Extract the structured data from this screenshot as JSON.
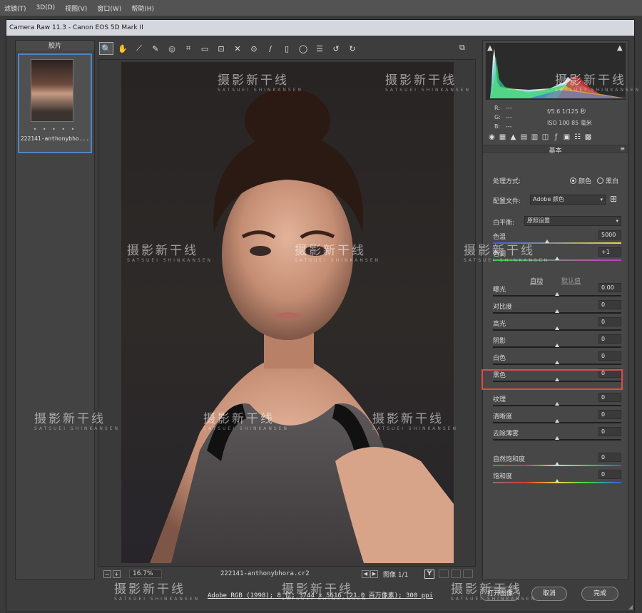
{
  "menubar": {
    "items": [
      "滤镜(T)",
      "3D(D)",
      "视图(V)",
      "窗口(W)",
      "帮助(H)"
    ]
  },
  "window": {
    "title": "Camera Raw 11.3 -  Canon EOS 5D Mark II"
  },
  "filmstrip": {
    "header": "胶片",
    "file_name": "222141-anthonybho...",
    "stars": "• • • • •"
  },
  "toolbar": {
    "tools": [
      {
        "name": "zoom-tool",
        "glyph": "🔍"
      },
      {
        "name": "hand-tool",
        "glyph": "✋"
      },
      {
        "name": "white-balance-tool",
        "glyph": "⟋"
      },
      {
        "name": "color-sampler-tool",
        "glyph": "✎"
      },
      {
        "name": "targeted-adjustment-tool",
        "glyph": "◎"
      },
      {
        "name": "crop-tool",
        "glyph": "⌗"
      },
      {
        "name": "straighten-tool",
        "glyph": "▭"
      },
      {
        "name": "transform-tool",
        "glyph": "⊡"
      },
      {
        "name": "spot-removal-tool",
        "glyph": "✕"
      },
      {
        "name": "red-eye-tool",
        "glyph": "⊙"
      },
      {
        "name": "adjustment-brush-tool",
        "glyph": "∕"
      },
      {
        "name": "graduated-filter-tool",
        "glyph": "▯"
      },
      {
        "name": "radial-filter-tool",
        "glyph": "◯"
      },
      {
        "name": "preferences-button",
        "glyph": "☰"
      },
      {
        "name": "rotate-left-button",
        "glyph": "↺"
      },
      {
        "name": "rotate-right-button",
        "glyph": "↻"
      }
    ]
  },
  "status": {
    "zoom": "16.7%",
    "file_name": "222141-anthonybhora.cr2",
    "image_label": "图像 1/1",
    "y_label": "Y"
  },
  "histogram": {
    "r_label": "R:",
    "g_label": "G:",
    "b_label": "B:",
    "r_val": "---",
    "g_val": "---",
    "b_val": "---",
    "exif_line1": "f/5.6   1/125 秒",
    "exif_line2": "ISO 100   85 毫米"
  },
  "basic": {
    "section_title": "基本",
    "treatment_label": "处理方式:",
    "treatment_color": "颜色",
    "treatment_bw": "黑白",
    "profile_label": "配置文件:",
    "profile_value": "Adobe 颜色",
    "wb_label": "白平衡:",
    "wb_value": "原照设置",
    "auto_link": "自动",
    "default_link": "默认值",
    "sliders": [
      {
        "key": "temperature",
        "label": "色温",
        "value": "5000",
        "pos": 0.42
      },
      {
        "key": "tint",
        "label": "色调",
        "value": "+1",
        "pos": 0.5
      },
      {
        "key": "exposure",
        "label": "曝光",
        "value": "0.00",
        "pos": 0.5
      },
      {
        "key": "contrast",
        "label": "对比度",
        "value": "0",
        "pos": 0.5
      },
      {
        "key": "highlights",
        "label": "高光",
        "value": "0",
        "pos": 0.5
      },
      {
        "key": "shadows",
        "label": "阴影",
        "value": "0",
        "pos": 0.5
      },
      {
        "key": "whites",
        "label": "白色",
        "value": "0",
        "pos": 0.5
      },
      {
        "key": "blacks",
        "label": "黑色",
        "value": "0",
        "pos": 0.5
      },
      {
        "key": "texture",
        "label": "纹理",
        "value": "0",
        "pos": 0.5
      },
      {
        "key": "clarity",
        "label": "清晰度",
        "value": "0",
        "pos": 0.5
      },
      {
        "key": "dehaze",
        "label": "去除薄雾",
        "value": "0",
        "pos": 0.5
      },
      {
        "key": "vibrance",
        "label": "自然饱和度",
        "value": "0",
        "pos": 0.5
      },
      {
        "key": "saturation",
        "label": "饱和度",
        "value": "0",
        "pos": 0.5
      }
    ]
  },
  "bottom": {
    "workflow_link": "Adobe RGB (1998); 8 位; 3744 x 5616 (21.0 百万像素); 300 ppi",
    "open_button": "打开图像",
    "cancel_button": "取消",
    "done_button": "完成"
  },
  "watermark": {
    "title": "摄影新干线",
    "sub": "SATSUEI SHINKANSEN"
  },
  "colors": {
    "highlight": "#e04a4a",
    "selection": "#4f86c6"
  }
}
